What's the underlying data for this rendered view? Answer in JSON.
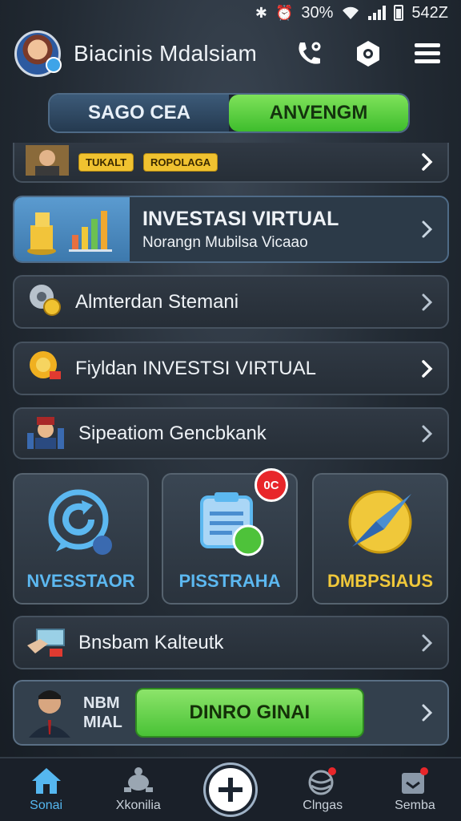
{
  "status_bar": {
    "time": "542Z",
    "battery": "30%"
  },
  "header": {
    "title": "Biacinis Mdalsiam",
    "avatar": "avatar",
    "icons": [
      "phone-icon",
      "settings-icon",
      "menu-icon"
    ]
  },
  "segment": {
    "left": "SAGO CEA",
    "right": "ANVENGM",
    "selected": "right"
  },
  "partial_row": {
    "tag1": "TUKALT",
    "tag2": "ROPOLAGA"
  },
  "invest_card": {
    "title": "INVESTASI VIRTUAL",
    "subtitle": "Norangn Mubilsa Vicaao"
  },
  "menu_rows": [
    {
      "label": "Almterdan Stemani",
      "icon": "gear-coin-icon"
    },
    {
      "label": "Fiyldan INVESTSI VIRTUAL",
      "icon": "gold-gear-icon"
    },
    {
      "label": "Sipeatiom Gencbkank",
      "icon": "user-chart-icon"
    }
  ],
  "tiles": [
    {
      "label": "NVESSTAOR",
      "icon": "refresh-chat-icon",
      "color": "#5cb8f0"
    },
    {
      "label": "PISSTRAHA",
      "icon": "clipboard-icon",
      "color": "#5cb8f0",
      "badge": "0C"
    },
    {
      "label": "DMBPSIAUS",
      "icon": "compass-icon",
      "color": "#f0c83a"
    }
  ],
  "row_after_tiles": {
    "label": "Bnsbam Kalteutk",
    "icon": "money-hand-icon"
  },
  "last_row": {
    "line1": "NBM",
    "line2": "MIAL",
    "cta": "DINRO GINAI"
  },
  "bottom_nav": [
    {
      "label": "Sonai",
      "icon": "home-icon",
      "active": true
    },
    {
      "label": "Xkonilia",
      "icon": "turtle-icon",
      "active": false
    },
    {
      "label": "",
      "icon": "plus-icon",
      "active": false
    },
    {
      "label": "Clngas",
      "icon": "globe-icon",
      "active": false
    },
    {
      "label": "Semba",
      "icon": "inbox-icon",
      "active": false
    }
  ],
  "colors": {
    "accent_green": "#49c236",
    "accent_blue": "#55b7f0",
    "accent_gold": "#f0c83a"
  }
}
